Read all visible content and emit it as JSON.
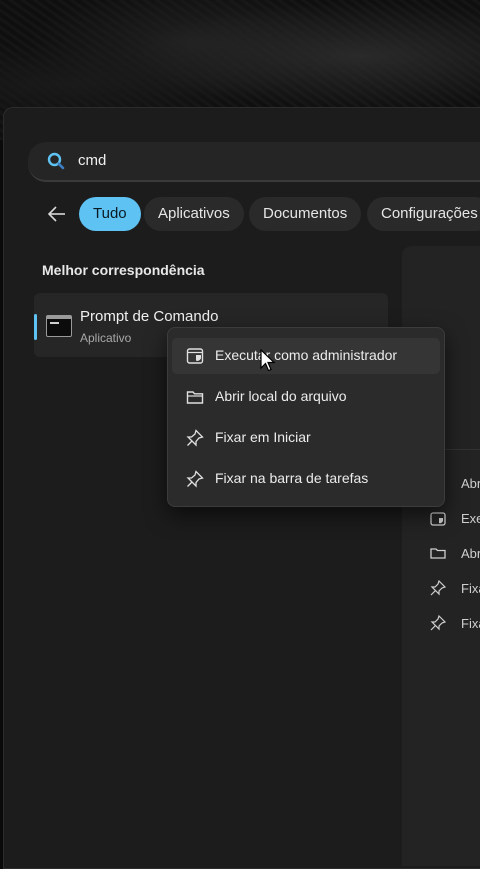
{
  "search": {
    "query": "cmd",
    "icon": "search-icon"
  },
  "filters": [
    {
      "label": "Tudo",
      "active": true
    },
    {
      "label": "Aplicativos",
      "active": false
    },
    {
      "label": "Documentos",
      "active": false
    },
    {
      "label": "Configurações",
      "active": false
    }
  ],
  "results": {
    "section_title": "Melhor correspondência",
    "best_match": {
      "name": "Prompt de Comando",
      "type": "Aplicativo",
      "icon": "terminal-icon"
    }
  },
  "context_menu": {
    "items": [
      {
        "label": "Executar como administrador",
        "icon": "shield-icon"
      },
      {
        "label": "Abrir local do arquivo",
        "icon": "folder-icon"
      },
      {
        "label": "Fixar em Iniciar",
        "icon": "pin-icon"
      },
      {
        "label": "Fixar na barra de tarefas",
        "icon": "pin-icon"
      }
    ]
  },
  "right_pane": {
    "items": [
      {
        "label": "Abr"
      },
      {
        "label": "Exe"
      },
      {
        "label": "Abr"
      },
      {
        "label": "Fixa"
      },
      {
        "label": "Fixa"
      }
    ]
  },
  "colors": {
    "accent": "#5ec2f2",
    "panel": "#1c1c1c",
    "menu": "#2b2b2b"
  }
}
